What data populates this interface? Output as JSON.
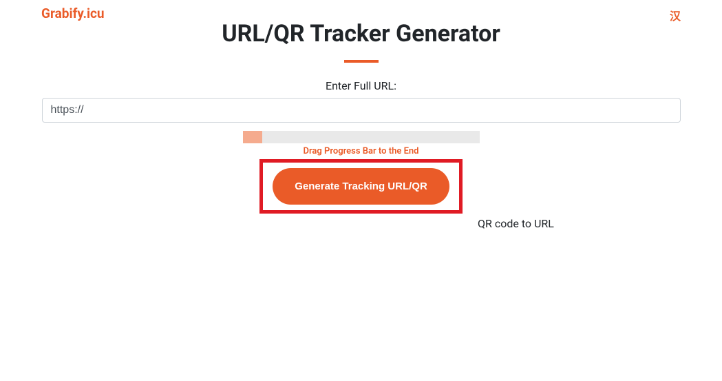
{
  "header": {
    "brand": "Grabify.icu",
    "lang_switch": "汉"
  },
  "main": {
    "title": "URL/QR Tracker Generator",
    "input_label": "Enter Full URL:",
    "input_value": "https://",
    "slider_hint": "Drag Progress Bar to the End",
    "generate_button": "Generate Tracking URL/QR",
    "qr_link": "QR code to URL"
  }
}
